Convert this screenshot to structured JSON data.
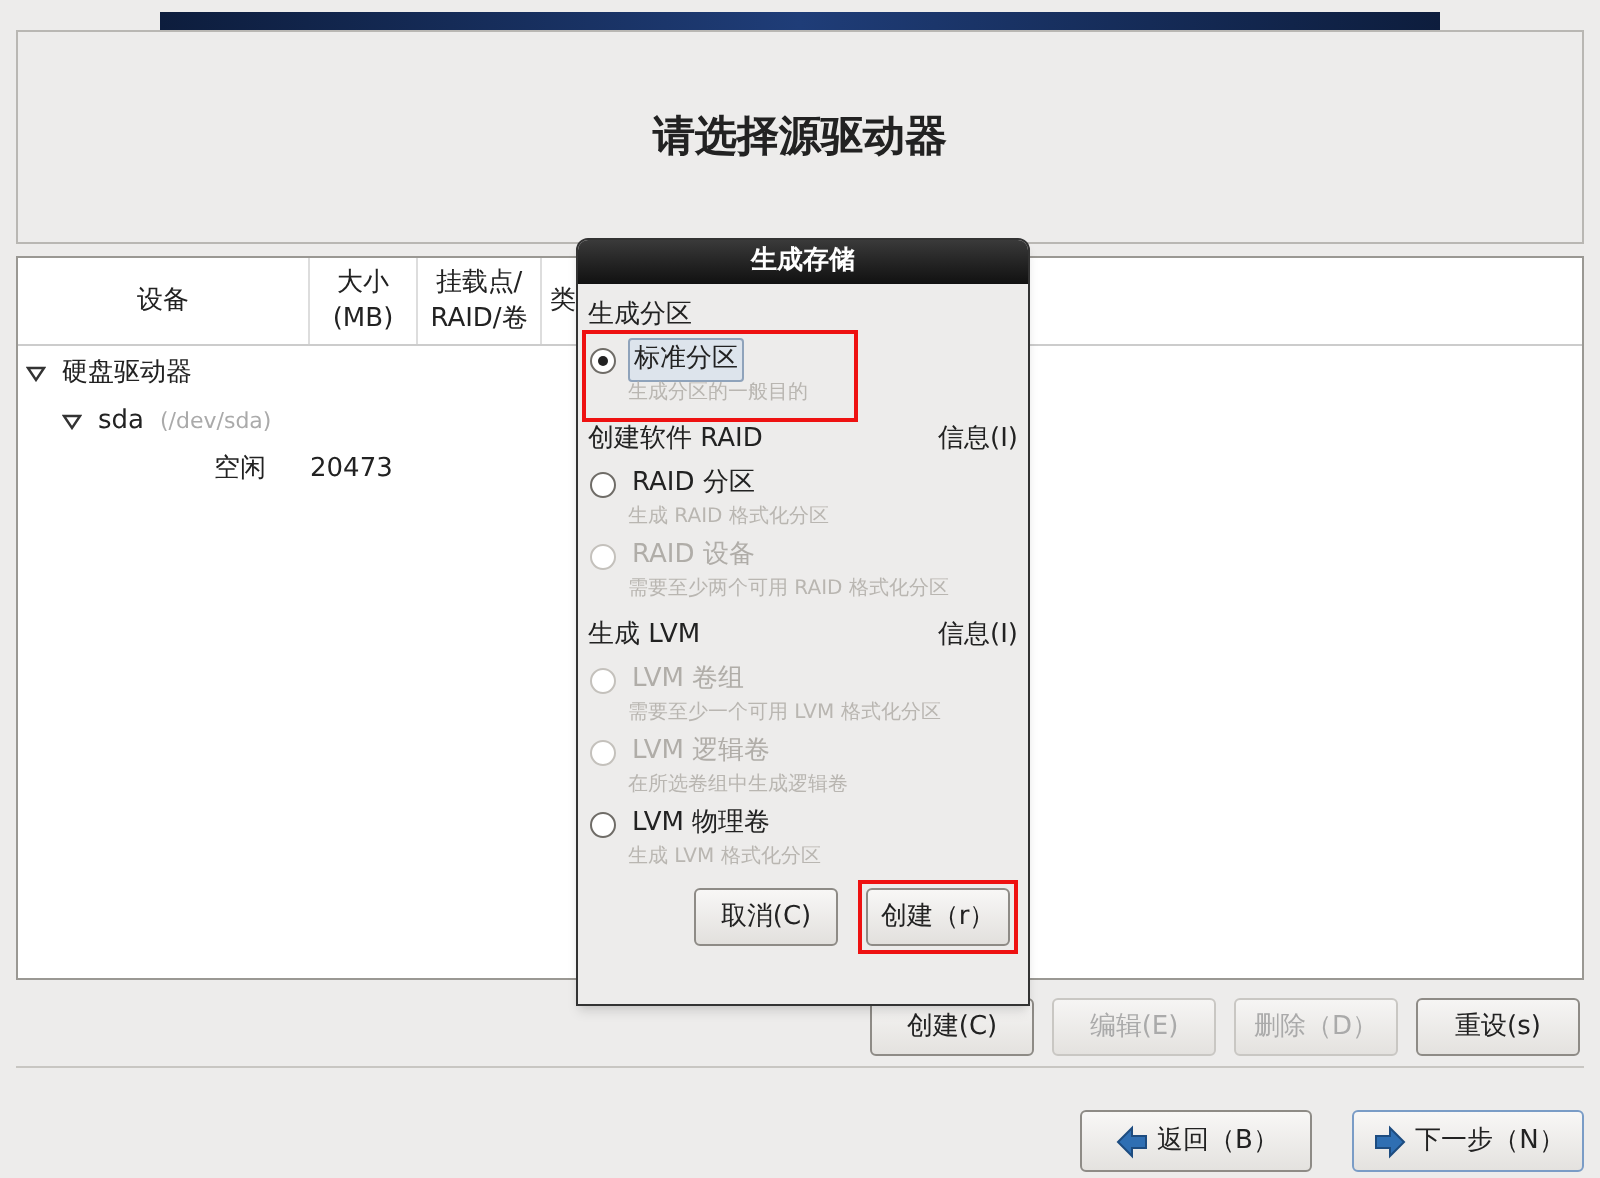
{
  "header": {
    "title": "请选择源驱动器"
  },
  "table": {
    "columns": [
      {
        "label": "设备"
      },
      {
        "label": "大小\n(MB)"
      },
      {
        "label": "挂载点/\nRAID/卷"
      },
      {
        "label": "类"
      }
    ],
    "rows": [
      {
        "device": "硬盘驱动器",
        "expanded": true,
        "children": [
          {
            "device": "sda",
            "path": "(/dev/sda)",
            "expanded": true,
            "children": [
              {
                "device": "空闲",
                "size": "20473"
              }
            ]
          }
        ]
      }
    ]
  },
  "actions": [
    {
      "label": "创建(C)",
      "disabled": false
    },
    {
      "label": "编辑(E)",
      "disabled": true
    },
    {
      "label": "删除（D）",
      "disabled": true
    },
    {
      "label": "重设(s)",
      "disabled": false
    }
  ],
  "nav": [
    {
      "label": "返回（B）",
      "kind": "back",
      "focused": false
    },
    {
      "label": "下一步（N）",
      "kind": "next",
      "focused": true
    }
  ],
  "dialog": {
    "title": "生成存储",
    "sections": [
      {
        "heading": "生成分区",
        "options": [
          {
            "label": "标准分区",
            "description": "生成分区的一般目的",
            "selected": true,
            "disabled": false,
            "highlighted": true
          }
        ]
      },
      {
        "heading": "创建软件 RAID",
        "info": "信息(I)",
        "options": [
          {
            "label": "RAID 分区",
            "description": "生成 RAID 格式化分区",
            "selected": false,
            "disabled": false,
            "highlighted": false
          },
          {
            "label": "RAID 设备",
            "description": "需要至少两个可用 RAID 格式化分区",
            "selected": false,
            "disabled": true,
            "highlighted": false
          }
        ]
      },
      {
        "heading": "生成 LVM",
        "info": "信息(I)",
        "options": [
          {
            "label": "LVM 卷组",
            "description": "需要至少一个可用 LVM 格式化分区",
            "selected": false,
            "disabled": true,
            "highlighted": false
          },
          {
            "label": "LVM 逻辑卷",
            "description": "在所选卷组中生成逻辑卷",
            "selected": false,
            "disabled": true,
            "highlighted": false
          },
          {
            "label": "LVM 物理卷",
            "description": "生成 LVM 格式化分区",
            "selected": false,
            "disabled": false,
            "highlighted": false
          }
        ]
      }
    ],
    "buttons": [
      {
        "label": "取消(C)",
        "highlighted": false
      },
      {
        "label": "创建（r）",
        "highlighted": true
      }
    ]
  }
}
